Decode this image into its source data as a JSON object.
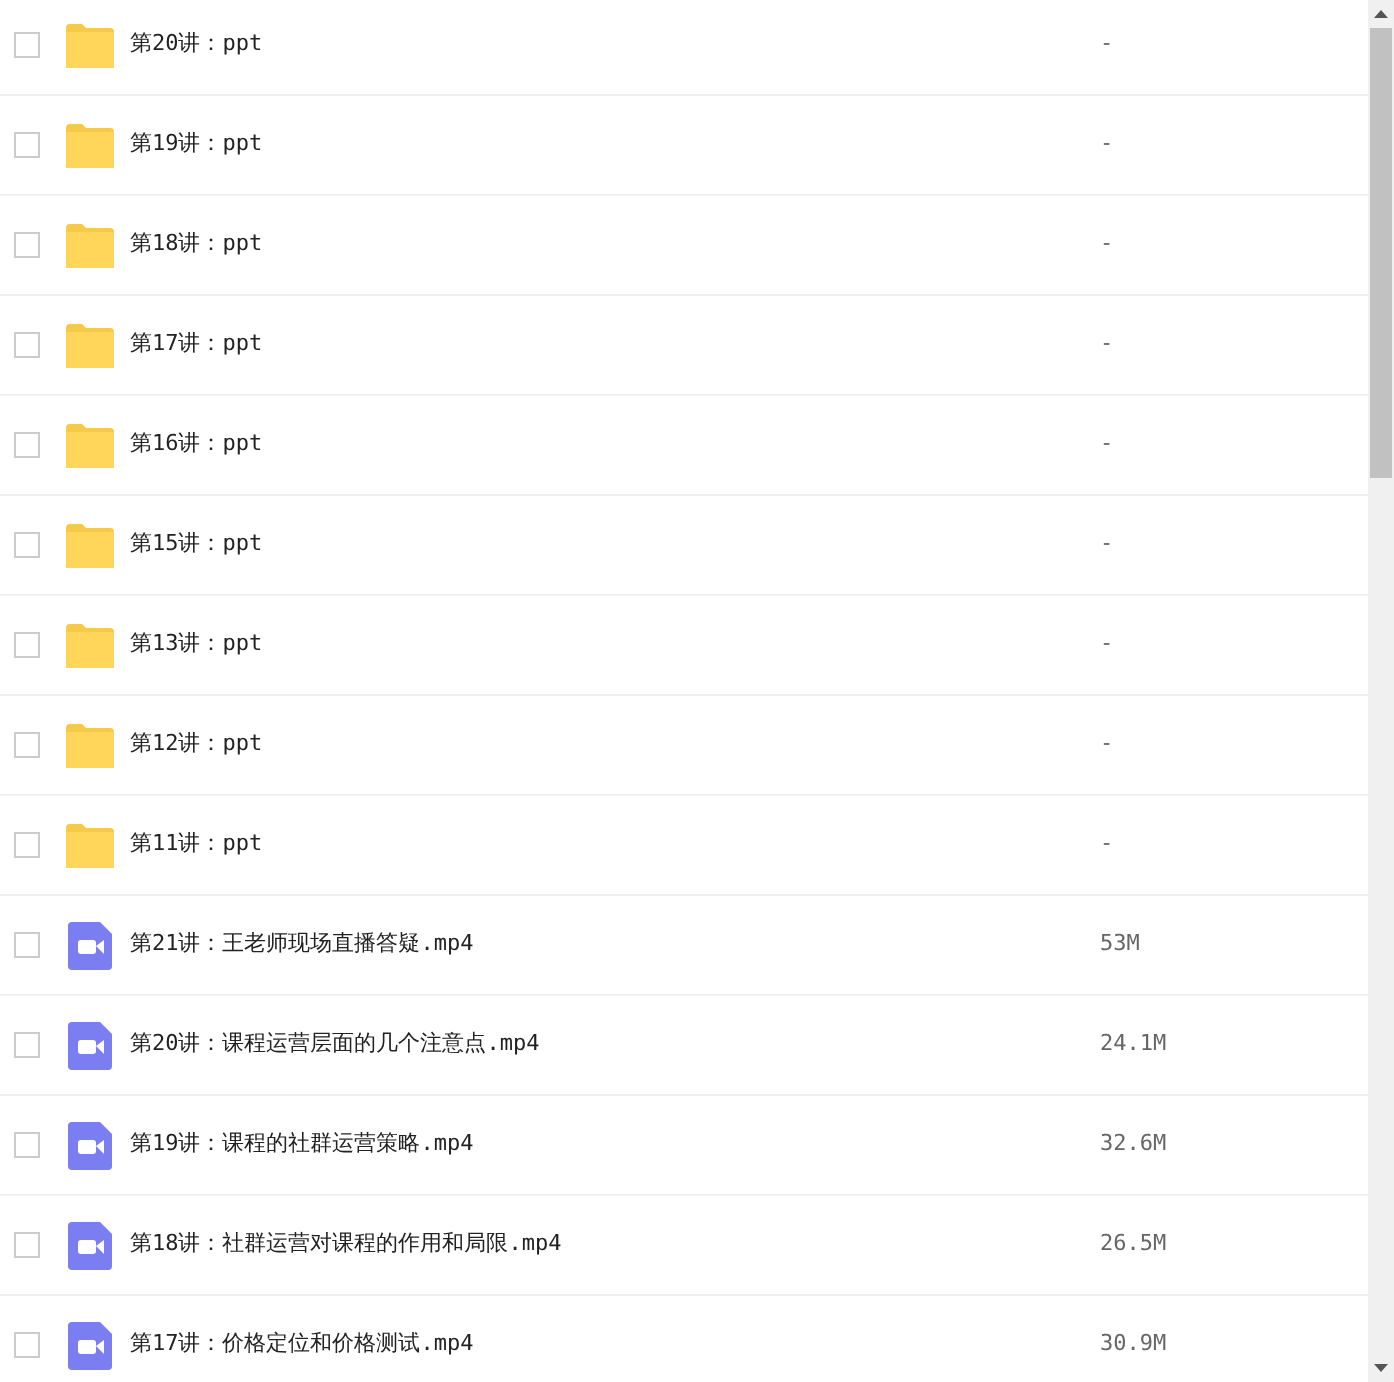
{
  "files": [
    {
      "kind": "folder",
      "name": "第20讲：ppt",
      "size": "-",
      "checked": false
    },
    {
      "kind": "folder",
      "name": "第19讲：ppt",
      "size": "-",
      "checked": false
    },
    {
      "kind": "folder",
      "name": "第18讲：ppt",
      "size": "-",
      "checked": false
    },
    {
      "kind": "folder",
      "name": "第17讲：ppt",
      "size": "-",
      "checked": false
    },
    {
      "kind": "folder",
      "name": "第16讲：ppt",
      "size": "-",
      "checked": false
    },
    {
      "kind": "folder",
      "name": "第15讲：ppt",
      "size": "-",
      "checked": false
    },
    {
      "kind": "folder",
      "name": "第13讲：ppt",
      "size": "-",
      "checked": false
    },
    {
      "kind": "folder",
      "name": "第12讲：ppt",
      "size": "-",
      "checked": false
    },
    {
      "kind": "folder",
      "name": "第11讲：ppt",
      "size": "-",
      "checked": false
    },
    {
      "kind": "video",
      "name": "第21讲：王老师现场直播答疑.mp4",
      "size": "53M",
      "checked": false
    },
    {
      "kind": "video",
      "name": "第20讲：课程运营层面的几个注意点.mp4",
      "size": "24.1M",
      "checked": false
    },
    {
      "kind": "video",
      "name": "第19讲：课程的社群运营策略.mp4",
      "size": "32.6M",
      "checked": false
    },
    {
      "kind": "video",
      "name": "第18讲：社群运营对课程的作用和局限.mp4",
      "size": "26.5M",
      "checked": false
    },
    {
      "kind": "video",
      "name": "第17讲：价格定位和价格测试.mp4",
      "size": "30.9M",
      "checked": false
    }
  ]
}
